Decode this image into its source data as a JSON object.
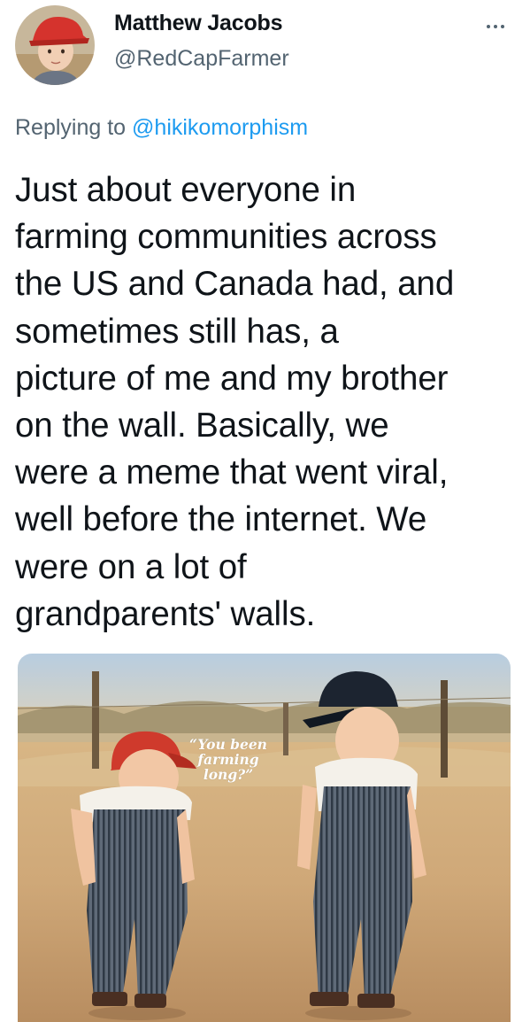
{
  "author": {
    "name": "Matthew Jacobs",
    "handle": "@RedCapFarmer",
    "avatar_icon": "avatar-photo"
  },
  "more_icon": "more-options-icon",
  "reply": {
    "prefix": "Replying to",
    "mention": "@hikikomorphism"
  },
  "tweet_text": "Just about everyone in\nfarming communities across\nthe US and Canada had, and\nsometimes still has, a\npicture of me and my brother\non the wall. Basically, we\nwere a meme that went viral,\nwell before the internet. We\nwere on a lot of\ngrandparents' walls.",
  "media": {
    "caption": "“You been\nfarming\nlong?”"
  },
  "colors": {
    "text": "#0f1419",
    "secondary": "#536471",
    "accent": "#1d9bf0"
  }
}
